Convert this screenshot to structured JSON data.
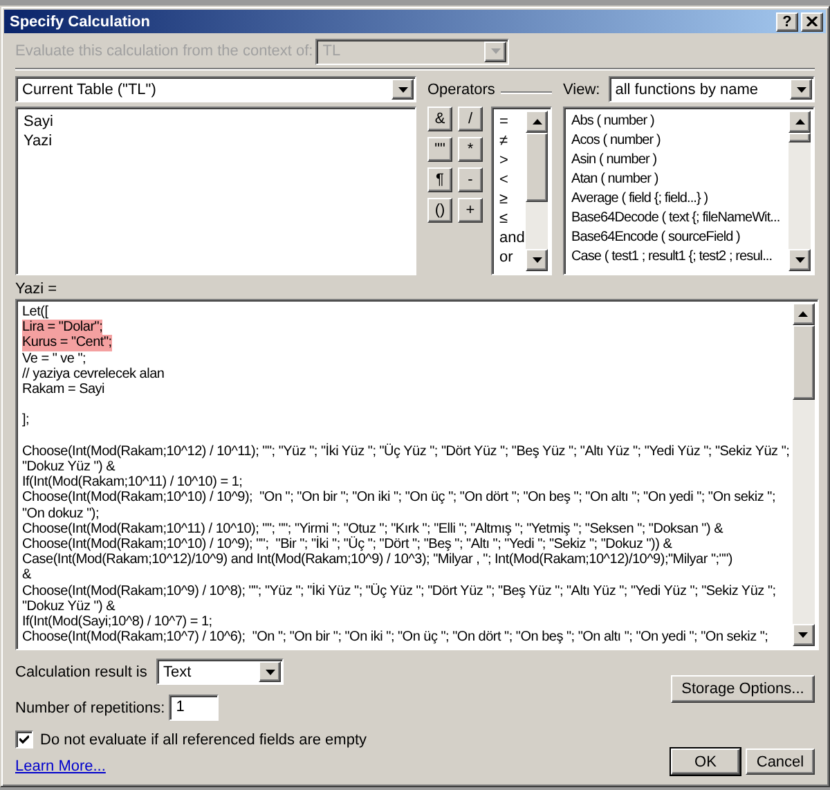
{
  "window": {
    "title": "Specify Calculation",
    "help_button": "?"
  },
  "context": {
    "label": "Evaluate this calculation from the context of:",
    "value": "TL",
    "disabled": true
  },
  "table_dropdown": {
    "value": "Current Table (\"TL\")"
  },
  "fields": [
    "Sayi",
    "Yazi"
  ],
  "operators": {
    "label": "Operators",
    "buttons": [
      "&",
      "/",
      "\"\"",
      "*",
      "¶",
      "-",
      "()",
      "+"
    ],
    "list": [
      "=",
      "≠",
      ">",
      "<",
      "≥",
      "≤",
      "and",
      "or"
    ]
  },
  "view": {
    "label": "View:",
    "value": "all functions by name"
  },
  "functions": [
    "Abs ( number )",
    "Acos ( number )",
    "Asin ( number )",
    "Atan ( number )",
    "Average ( field {; field...} )",
    "Base64Decode ( text {; fileNameWit...",
    "Base64Encode ( sourceField )",
    "Case ( test1 ; result1 {; test2 ; resul..."
  ],
  "formula": {
    "label": "Yazi =",
    "lines": [
      {
        "text": "Let([",
        "highlighted": false,
        "gap_before": false
      },
      {
        "text": "Lira = \"Dolar\";",
        "highlighted": true,
        "gap_before": false
      },
      {
        "text": "Kurus = \"Cent\";",
        "highlighted": true,
        "gap_before": false
      },
      {
        "text": "Ve = \" ve \";",
        "highlighted": false,
        "gap_before": false
      },
      {
        "text": "// yaziya cevrelecek alan",
        "highlighted": false,
        "gap_before": false
      },
      {
        "text": "Rakam = Sayi",
        "highlighted": false,
        "gap_before": false
      },
      {
        "text": "];",
        "highlighted": false,
        "gap_before": true
      },
      {
        "text": "Choose(Int(Mod(Rakam;10^12) / 10^11); \"\"; \"Yüz \"; \"İki Yüz \"; \"Üç Yüz \"; \"Dört Yüz \"; \"Beş Yüz \"; \"Altı Yüz \"; \"Yedi Yüz \"; \"Sekiz Yüz \";",
        "highlighted": false,
        "gap_before": true
      },
      {
        "text": "\"Dokuz Yüz \") &",
        "highlighted": false,
        "gap_before": false
      },
      {
        "text": "If(Int(Mod(Rakam;10^11) / 10^10) = 1;",
        "highlighted": false,
        "gap_before": false
      },
      {
        "text": "Choose(Int(Mod(Rakam;10^10) / 10^9);  \"On \"; \"On bir \"; \"On iki \"; \"On üç \"; \"On dört \"; \"On beş \"; \"On altı \"; \"On yedi \"; \"On sekiz \";",
        "highlighted": false,
        "gap_before": false
      },
      {
        "text": "\"On dokuz \");",
        "highlighted": false,
        "gap_before": false
      },
      {
        "text": "Choose(Int(Mod(Rakam;10^11) / 10^10); \"\"; \"\"; \"Yirmi \"; \"Otuz \"; \"Kırk \"; \"Elli \"; \"Altmış \"; \"Yetmiş \"; \"Seksen \"; \"Doksan \") &",
        "highlighted": false,
        "gap_before": false
      },
      {
        "text": "Choose(Int(Mod(Rakam;10^10) / 10^9); \"\";  \"Bir \"; \"İki \"; \"Üç \"; \"Dört \"; \"Beş \"; \"Altı \"; \"Yedi \"; \"Sekiz \"; \"Dokuz \")) &",
        "highlighted": false,
        "gap_before": false
      },
      {
        "text": "Case(Int(Mod(Rakam;10^12)/10^9) and Int(Mod(Rakam;10^9) / 10^3); \"Milyar , \"; Int(Mod(Rakam;10^12)/10^9);\"Milyar \";\"\")",
        "highlighted": false,
        "gap_before": false
      },
      {
        "text": "&",
        "highlighted": false,
        "gap_before": false
      },
      {
        "text": "Choose(Int(Mod(Rakam;10^9) / 10^8); \"\"; \"Yüz \"; \"İki Yüz \"; \"Üç Yüz \"; \"Dört Yüz \"; \"Beş Yüz \"; \"Altı Yüz \"; \"Yedi Yüz \"; \"Sekiz Yüz \";",
        "highlighted": false,
        "gap_before": false
      },
      {
        "text": "\"Dokuz Yüz \") &",
        "highlighted": false,
        "gap_before": false
      },
      {
        "text": "If(Int(Mod(Sayi;10^8) / 10^7) = 1;",
        "highlighted": false,
        "gap_before": false
      },
      {
        "text": "Choose(Int(Mod(Rakam;10^7) / 10^6);  \"On \"; \"On bir \"; \"On iki \"; \"On üç \"; \"On dört \"; \"On beş \"; \"On altı \"; \"On yedi \"; \"On sekiz \";",
        "highlighted": false,
        "gap_before": false
      }
    ]
  },
  "result_type": {
    "label": "Calculation result is",
    "value": "Text"
  },
  "repetitions": {
    "label": "Number of repetitions:",
    "value": "1"
  },
  "do_not_evaluate": {
    "label": "Do not evaluate if all referenced fields are empty",
    "checked": true
  },
  "learn_more": "Learn More...",
  "buttons": {
    "storage_options": "Storage Options...",
    "ok": "OK",
    "cancel": "Cancel"
  }
}
